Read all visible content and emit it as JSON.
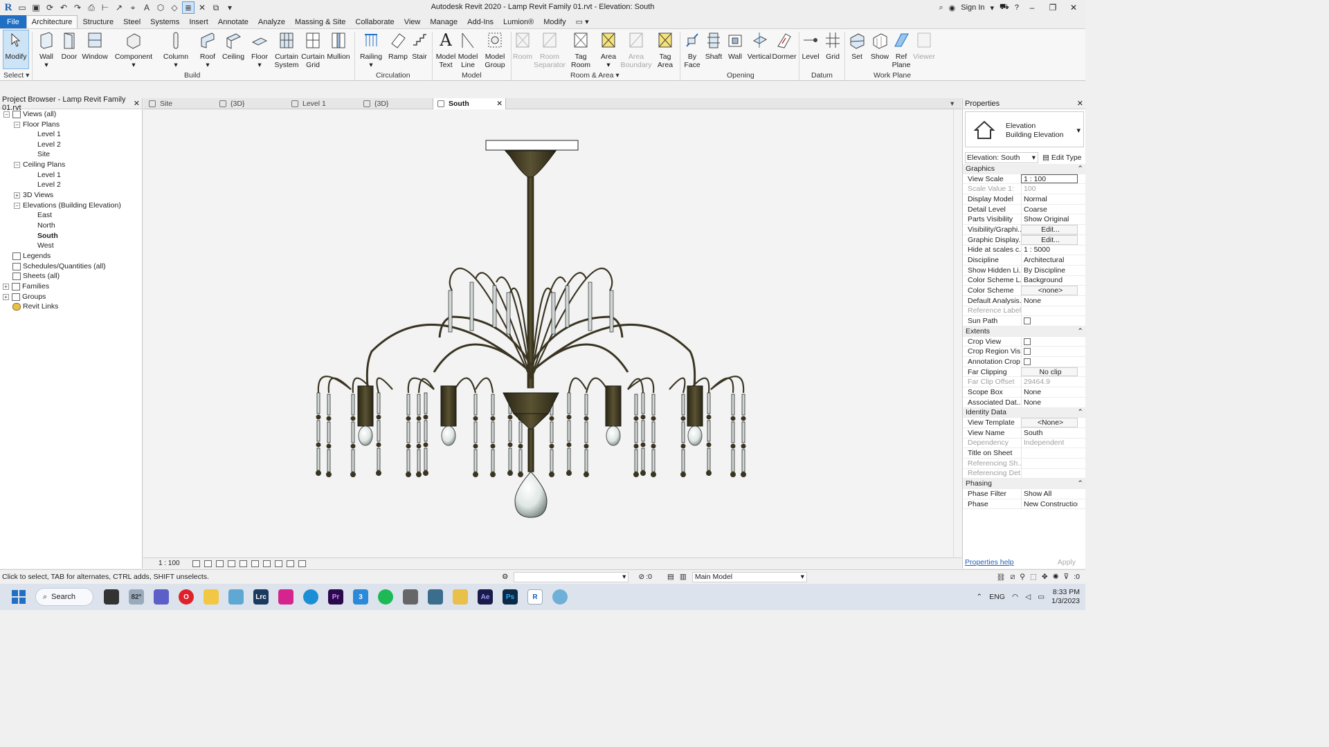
{
  "window": {
    "title": "Autodesk Revit 2020 - Lamp Revit Family 01.rvt - Elevation: South",
    "sign_in": "Sign In"
  },
  "menu": {
    "tabs": [
      "File",
      "Architecture",
      "Structure",
      "Steel",
      "Systems",
      "Insert",
      "Annotate",
      "Analyze",
      "Massing & Site",
      "Collaborate",
      "View",
      "Manage",
      "Add-Ins",
      "Lumion®",
      "Modify"
    ],
    "active": "Architecture"
  },
  "ribbon": {
    "select": {
      "modify": "Modify",
      "panel": "Select"
    },
    "build": {
      "wall": "Wall",
      "door": "Door",
      "window": "Window",
      "component": "Component",
      "column": "Column",
      "roof": "Roof",
      "ceiling": "Ceiling",
      "floor": "Floor",
      "curtain_system_1": "Curtain",
      "curtain_system_2": "System",
      "curtain_grid_1": "Curtain",
      "curtain_grid_2": "Grid",
      "mullion": "Mullion",
      "panel": "Build"
    },
    "circulation": {
      "railing": "Railing",
      "ramp": "Ramp",
      "stair": "Stair",
      "panel": "Circulation"
    },
    "model": {
      "model_text_1": "Model",
      "model_text_2": "Text",
      "model_line_1": "Model",
      "model_line_2": "Line",
      "model_group_1": "Model",
      "model_group_2": "Group",
      "panel": "Model"
    },
    "room_area": {
      "room": "Room",
      "room_sep_1": "Room",
      "room_sep_2": "Separator",
      "tag_room_1": "Tag",
      "tag_room_2": "Room",
      "area": "Area",
      "area_boundary_1": "Area",
      "area_boundary_2": "Boundary",
      "tag_area_1": "Tag",
      "tag_area_2": "Area",
      "panel": "Room & Area"
    },
    "opening": {
      "by_face_1": "By",
      "by_face_2": "Face",
      "shaft": "Shaft",
      "wall": "Wall",
      "vertical": "Vertical",
      "dormer": "Dormer",
      "panel": "Opening"
    },
    "datum": {
      "level": "Level",
      "grid": "Grid",
      "panel": "Datum"
    },
    "work_plane": {
      "set": "Set",
      "show": "Show",
      "ref_plane_1": "Ref",
      "ref_plane_2": "Plane",
      "viewer": "Viewer",
      "panel": "Work Plane"
    }
  },
  "project_browser": {
    "title": "Project Browser - Lamp Revit Family 01.rvt",
    "items": {
      "views_all": "Views (all)",
      "floor_plans": "Floor Plans",
      "fp_level1": "Level 1",
      "fp_level2": "Level 2",
      "fp_site": "Site",
      "ceiling_plans": "Ceiling Plans",
      "cp_level1": "Level 1",
      "cp_level2": "Level 2",
      "views_3d": "3D Views",
      "elevations": "Elevations (Building Elevation)",
      "east": "East",
      "north": "North",
      "south": "South",
      "west": "West",
      "legends": "Legends",
      "schedules": "Schedules/Quantities (all)",
      "sheets": "Sheets (all)",
      "families": "Families",
      "groups": "Groups",
      "revit_links": "Revit Links"
    }
  },
  "view_tabs": {
    "t1": "Site",
    "t2": "{3D}",
    "t3": "Level 1",
    "t4": "{3D}",
    "t5": "South"
  },
  "view_control": {
    "scale": "1 : 100"
  },
  "properties": {
    "title": "Properties",
    "type_line1": "Elevation",
    "type_line2": "Building Elevation",
    "instance": "Elevation: South",
    "edit_type": "Edit Type",
    "groups": {
      "graphics": "Graphics",
      "extents": "Extents",
      "identity": "Identity Data",
      "phasing": "Phasing"
    },
    "rows": {
      "view_scale": [
        "View Scale",
        "1 : 100"
      ],
      "scale_value": [
        "Scale Value   1:",
        "100"
      ],
      "display_model": [
        "Display Model",
        "Normal"
      ],
      "detail_level": [
        "Detail Level",
        "Coarse"
      ],
      "parts_visibility": [
        "Parts Visibility",
        "Show Original"
      ],
      "vis_graphics": [
        "Visibility/Graphi...",
        "Edit..."
      ],
      "graphic_display": [
        "Graphic Display...",
        "Edit..."
      ],
      "hide_at_scales": [
        "Hide at scales c...",
        "1 : 5000"
      ],
      "discipline": [
        "Discipline",
        "Architectural"
      ],
      "show_hidden": [
        "Show Hidden Li...",
        "By Discipline"
      ],
      "color_scheme_loc": [
        "Color Scheme L...",
        "Background"
      ],
      "color_scheme": [
        "Color Scheme",
        "<none>"
      ],
      "default_analysis": [
        "Default Analysis...",
        "None"
      ],
      "reference_label": [
        "Reference Label",
        ""
      ],
      "sun_path": [
        "Sun Path",
        ""
      ],
      "crop_view": [
        "Crop View",
        ""
      ],
      "crop_region": [
        "Crop Region Vis...",
        ""
      ],
      "annotation_crop": [
        "Annotation Crop",
        ""
      ],
      "far_clipping": [
        "Far Clipping",
        "No clip"
      ],
      "far_clip_offset": [
        "Far Clip Offset",
        "29464.9"
      ],
      "scope_box": [
        "Scope Box",
        "None"
      ],
      "associated_dat": [
        "Associated Dat...",
        "None"
      ],
      "view_template": [
        "View Template",
        "<None>"
      ],
      "view_name": [
        "View Name",
        "South"
      ],
      "dependency": [
        "Dependency",
        "Independent"
      ],
      "title_on_sheet": [
        "Title on Sheet",
        ""
      ],
      "referencing_sh": [
        "Referencing Sh...",
        ""
      ],
      "referencing_det": [
        "Referencing Det...",
        ""
      ],
      "phase_filter": [
        "Phase Filter",
        "Show All"
      ],
      "phase": [
        "Phase",
        "New Construction"
      ]
    },
    "help": "Properties help",
    "apply": "Apply"
  },
  "status": {
    "message": "Click to select, TAB for alternates, CTRL adds, SHIFT unselects.",
    "counter": ":0",
    "model": "Main Model",
    "filter_count": ":0"
  },
  "taskbar": {
    "search": "Search",
    "weather": "82°",
    "lang": "ENG",
    "time": "8:33 PM",
    "date": "1/3/2023"
  },
  "colors": {
    "accent": "#1f6fc5",
    "brass": "#3a3522",
    "canvas_bg": "#f3f3f3"
  }
}
